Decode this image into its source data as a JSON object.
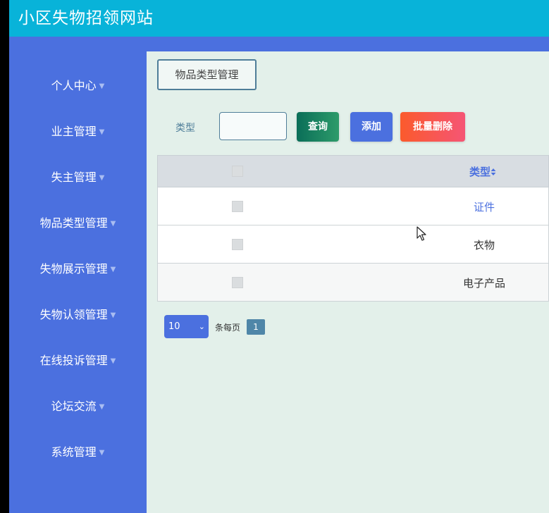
{
  "app": {
    "title": "小区失物招领网站"
  },
  "sidebar": {
    "items": [
      {
        "label": "个人中心"
      },
      {
        "label": "业主管理"
      },
      {
        "label": "失主管理"
      },
      {
        "label": "物品类型管理"
      },
      {
        "label": "失物展示管理"
      },
      {
        "label": "失物认领管理"
      },
      {
        "label": "在线投诉管理"
      },
      {
        "label": "论坛交流"
      },
      {
        "label": "系统管理"
      }
    ]
  },
  "breadcrumb": {
    "label": "物品类型管理"
  },
  "search": {
    "label": "类型",
    "value": ""
  },
  "buttons": {
    "query": "查询",
    "add": "添加",
    "batch_delete": "批量删除"
  },
  "table": {
    "columns": [
      {
        "label": "类型"
      }
    ],
    "rows": [
      {
        "type": "证件"
      },
      {
        "type": "衣物"
      },
      {
        "type": "电子产品"
      }
    ]
  },
  "pagination": {
    "page_size": "10",
    "per_page_label": "条每页",
    "current_page": "1"
  },
  "colors": {
    "header": "#08b3d9",
    "sidebar": "#4b70df",
    "accent": "#4b70df"
  }
}
